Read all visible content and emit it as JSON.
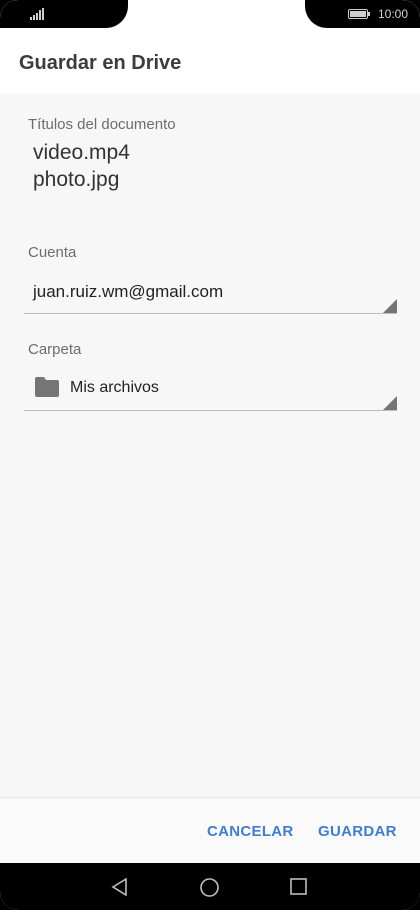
{
  "status_bar": {
    "time": "10:00"
  },
  "header": {
    "title": "Guardar en Drive"
  },
  "form": {
    "titles_label": "Títulos del documento",
    "documents": [
      "video.mp4",
      "photo.jpg"
    ],
    "account_label": "Cuenta",
    "account_value": "juan.ruiz.wm@gmail.com",
    "folder_label": "Carpeta",
    "folder_value": "Mis archivos"
  },
  "actions": {
    "cancel_label": "CANCELAR",
    "save_label": "GUARDAR"
  },
  "colors": {
    "accent": "#3f7ec9",
    "title": "#3c3c3c",
    "label": "#6d6d6d"
  },
  "icons": [
    "signal-icon",
    "battery-icon",
    "folder-icon",
    "dropdown-arrow-icon",
    "back-icon",
    "home-icon",
    "recents-icon"
  ]
}
